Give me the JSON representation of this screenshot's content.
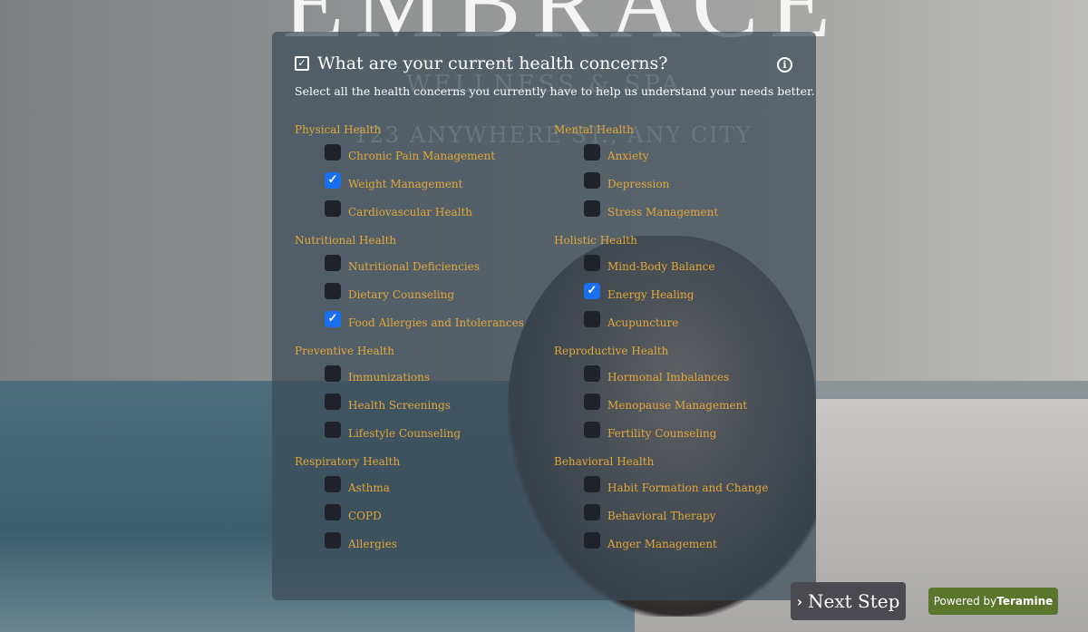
{
  "background": {
    "brand_title": "EMBRACE",
    "brand_subtitle": "WELLNESS & SPA",
    "brand_address": "123 ANYWHERE ST., ANY CITY"
  },
  "question": {
    "title": "What are your current health concerns?",
    "description": "Select all the health concerns you currently have to help us understand your needs better."
  },
  "categories": [
    {
      "label": "Physical Health",
      "options": [
        {
          "label": "Chronic Pain Management",
          "checked": false
        },
        {
          "label": "Weight Management",
          "checked": true
        },
        {
          "label": "Cardiovascular Health",
          "checked": false
        }
      ]
    },
    {
      "label": "Mental Health",
      "options": [
        {
          "label": "Anxiety",
          "checked": false
        },
        {
          "label": "Depression",
          "checked": false
        },
        {
          "label": "Stress Management",
          "checked": false
        }
      ]
    },
    {
      "label": "Nutritional Health",
      "options": [
        {
          "label": "Nutritional Deficiencies",
          "checked": false
        },
        {
          "label": "Dietary Counseling",
          "checked": false
        },
        {
          "label": "Food Allergies and Intolerances",
          "checked": true
        }
      ]
    },
    {
      "label": "Holistic Health",
      "options": [
        {
          "label": "Mind-Body Balance",
          "checked": false
        },
        {
          "label": "Energy Healing",
          "checked": true
        },
        {
          "label": "Acupuncture",
          "checked": false
        }
      ]
    },
    {
      "label": "Preventive Health",
      "options": [
        {
          "label": "Immunizations",
          "checked": false
        },
        {
          "label": "Health Screenings",
          "checked": false
        },
        {
          "label": "Lifestyle Counseling",
          "checked": false
        }
      ]
    },
    {
      "label": "Reproductive Health",
      "options": [
        {
          "label": "Hormonal Imbalances",
          "checked": false
        },
        {
          "label": "Menopause Management",
          "checked": false
        },
        {
          "label": "Fertility Counseling",
          "checked": false
        }
      ]
    },
    {
      "label": "Respiratory Health",
      "options": [
        {
          "label": "Asthma",
          "checked": false
        },
        {
          "label": "COPD",
          "checked": false
        },
        {
          "label": "Allergies",
          "checked": false
        }
      ]
    },
    {
      "label": "Behavioral Health",
      "options": [
        {
          "label": "Habit Formation and Change",
          "checked": false
        },
        {
          "label": "Behavioral Therapy",
          "checked": false
        },
        {
          "label": "Anger Management",
          "checked": false
        }
      ]
    }
  ],
  "footer": {
    "next_label": "Next Step",
    "powered_prefix": "Powered by",
    "powered_brand": "Teramine"
  },
  "colors": {
    "accent": "#e0a83a",
    "checked": "#1a6ef0",
    "powered_bg": "#5a762d"
  }
}
